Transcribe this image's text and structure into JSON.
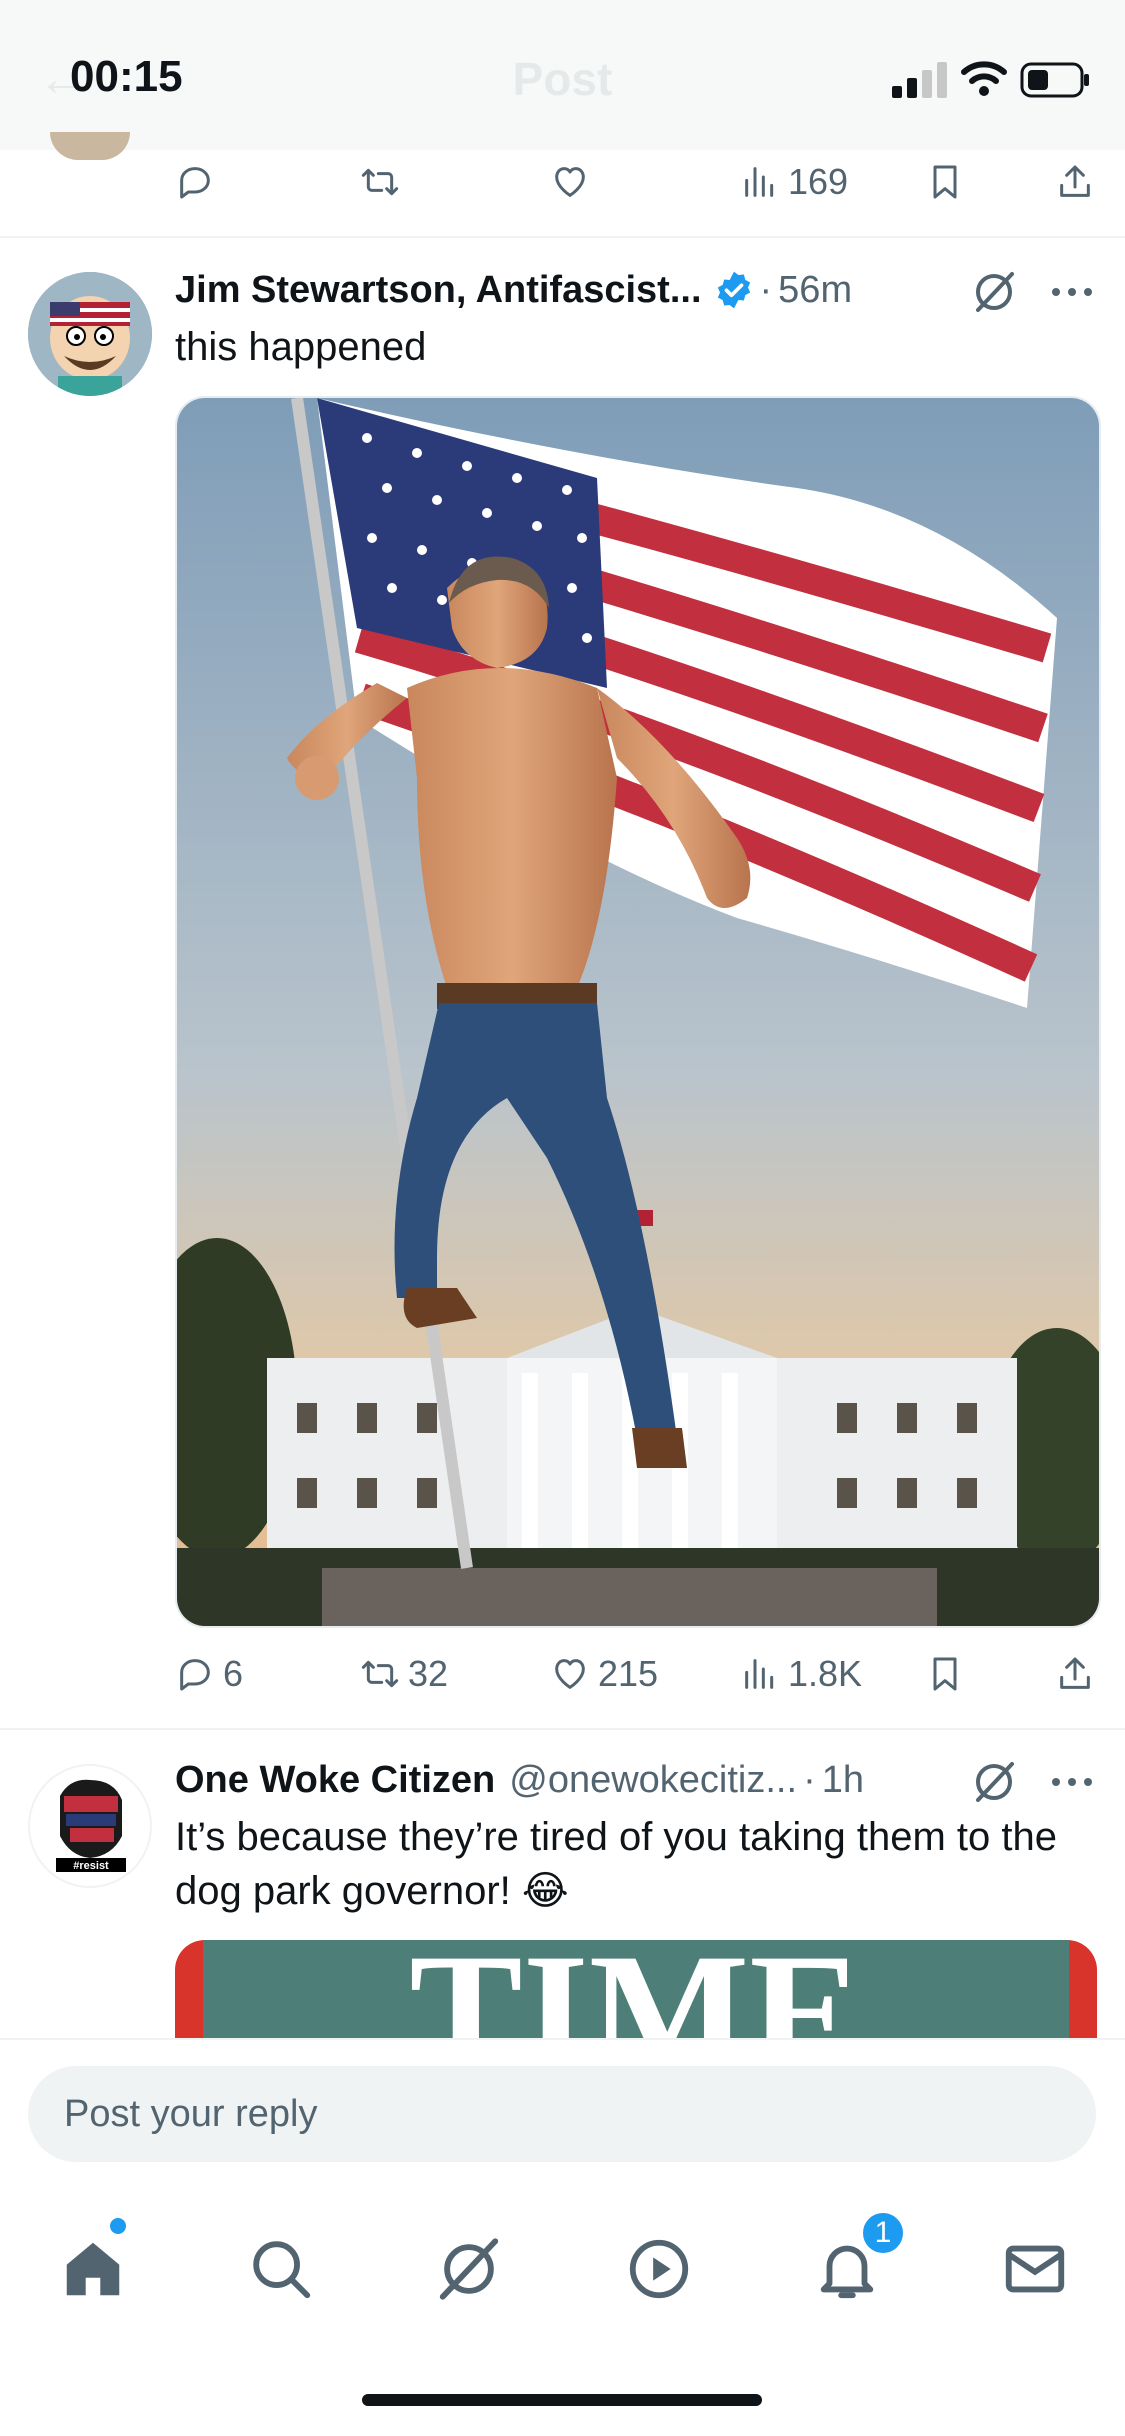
{
  "status_bar": {
    "time": "00:15"
  },
  "header": {
    "title": "Post",
    "back_icon": "arrow-left-icon"
  },
  "previous_post": {
    "actions": [
      {
        "icon": "reply-icon",
        "count": ""
      },
      {
        "icon": "repost-icon",
        "count": ""
      },
      {
        "icon": "like-icon",
        "count": ""
      },
      {
        "icon": "views-icon",
        "count": "169"
      },
      {
        "icon": "bookmark-icon",
        "count": ""
      },
      {
        "icon": "share-icon",
        "count": ""
      }
    ]
  },
  "post1": {
    "name": "Jim Stewartson, Antifascist...",
    "verified": true,
    "dot": "·",
    "time": "56m",
    "text": "this happened",
    "actions": [
      {
        "icon": "reply-icon",
        "count": "6"
      },
      {
        "icon": "repost-icon",
        "count": "32"
      },
      {
        "icon": "like-icon",
        "count": "215"
      },
      {
        "icon": "views-icon",
        "count": "1.8K"
      },
      {
        "icon": "bookmark-icon",
        "count": ""
      },
      {
        "icon": "share-icon",
        "count": ""
      }
    ]
  },
  "post2": {
    "name": "One Woke Citizen",
    "handle": "@onewokecitiz...",
    "dot": "·",
    "time": "1h",
    "text": "It’s because they’re tired of you taking them to the dog park governor! 😂",
    "avatar_text": "#resist",
    "media_text": "TIME"
  },
  "reply": {
    "placeholder": "Post your reply"
  },
  "bottom_nav": {
    "items": [
      "home-icon",
      "search-icon",
      "grok-icon",
      "video-icon",
      "notifications-icon",
      "messages-icon"
    ],
    "notification_count": "1"
  },
  "colors": {
    "accent": "#1d9bf0",
    "text": "#0f1419",
    "secondary": "#536471"
  }
}
